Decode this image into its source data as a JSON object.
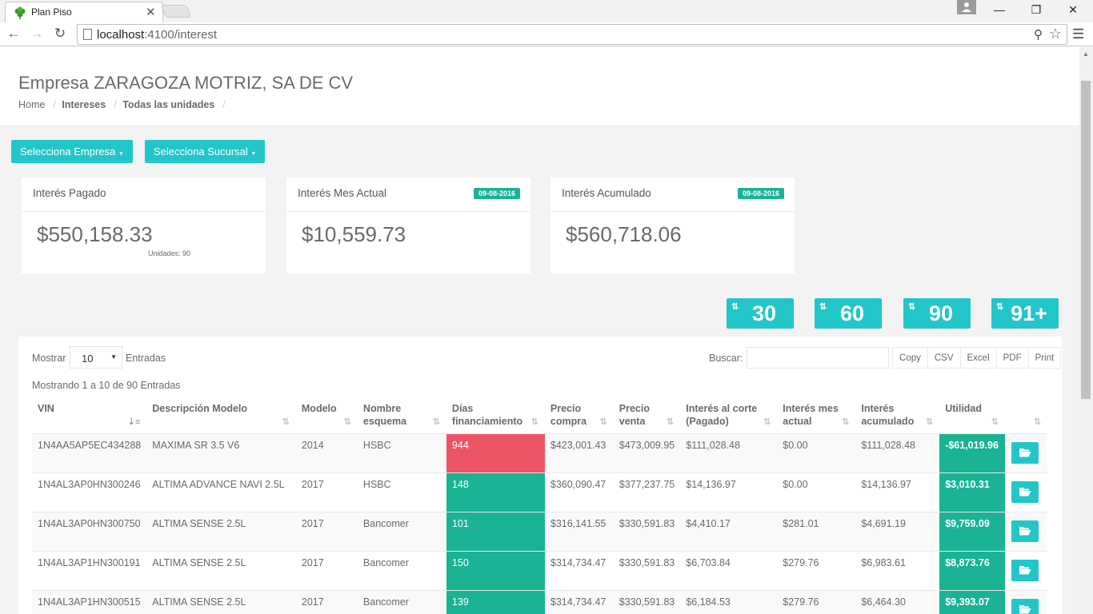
{
  "browser": {
    "tab_title": "Plan Piso",
    "url_host": "localhost",
    "url_rest": ":4100/interest"
  },
  "header": {
    "title": "Empresa ZARAGOZA MOTRIZ, SA DE CV",
    "breadcrumb": [
      "Home",
      "Intereses",
      "Todas las unidades"
    ]
  },
  "filters": {
    "empresa_label": "Selecciona Empresa",
    "sucursal_label": "Selecciona Sucursal"
  },
  "cards": [
    {
      "title": "Interés Pagado",
      "value": "$550,158.33",
      "sub": "Unidades: 90",
      "badge": ""
    },
    {
      "title": "Interés Mes Actual",
      "value": "$10,559.73",
      "sub": "",
      "badge": "09-08-2016"
    },
    {
      "title": "Interés Acumulado",
      "value": "$560,718.06",
      "sub": "",
      "badge": "09-08-2016"
    }
  ],
  "ranges": [
    "30",
    "60",
    "90",
    "91+"
  ],
  "table": {
    "show_label": "Mostrar",
    "length_value": "10",
    "entries_label": "Entradas",
    "search_label": "Buscar:",
    "exports": [
      "Copy",
      "CSV",
      "Excel",
      "PDF",
      "Print"
    ],
    "info": "Mostrando 1 a 10 de 90 Entradas",
    "columns": [
      "VIN",
      "Descripción Modelo",
      "Modelo",
      "Nombre esquema",
      "Días financiamiento",
      "Precio compra",
      "Precio venta",
      "Interés al corte (Pagado)",
      "Interés mes actual",
      "Interés acumulado",
      "Utilidad",
      ""
    ],
    "rows": [
      {
        "vin": "1N4AA5AP5EC434288",
        "desc": "MAXIMA SR 3.5 V6",
        "modelo": "2014",
        "esquema": "HSBC",
        "dias": "944",
        "dias_status": "red",
        "compra": "$423,001.43",
        "venta": "$473,009.95",
        "corte": "$111,028.48",
        "mes": "$0.00",
        "acum": "$111,028.48",
        "util": "-$61,019.96"
      },
      {
        "vin": "1N4AL3AP0HN300246",
        "desc": "ALTIMA ADVANCE NAVI 2.5L",
        "modelo": "2017",
        "esquema": "HSBC",
        "dias": "148",
        "dias_status": "green",
        "compra": "$360,090.47",
        "venta": "$377,237.75",
        "corte": "$14,136.97",
        "mes": "$0.00",
        "acum": "$14,136.97",
        "util": "$3,010.31"
      },
      {
        "vin": "1N4AL3AP0HN300750",
        "desc": "ALTIMA SENSE 2.5L",
        "modelo": "2017",
        "esquema": "Bancomer",
        "dias": "101",
        "dias_status": "green",
        "compra": "$316,141.55",
        "venta": "$330,591.83",
        "corte": "$4,410.17",
        "mes": "$281.01",
        "acum": "$4,691.19",
        "util": "$9,759.09"
      },
      {
        "vin": "1N4AL3AP1HN300191",
        "desc": "ALTIMA SENSE 2.5L",
        "modelo": "2017",
        "esquema": "Bancomer",
        "dias": "150",
        "dias_status": "green",
        "compra": "$314,734.47",
        "venta": "$330,591.83",
        "corte": "$6,703.84",
        "mes": "$279.76",
        "acum": "$6,983.61",
        "util": "$8,873.76"
      },
      {
        "vin": "1N4AL3AP1HN300515",
        "desc": "ALTIMA SENSE 2.5L",
        "modelo": "2017",
        "esquema": "Bancomer",
        "dias": "139",
        "dias_status": "green",
        "compra": "$314,734.47",
        "venta": "$330,591.83",
        "corte": "$6,184.53",
        "mes": "$279.76",
        "acum": "$6,464.30",
        "util": "$9,393.07"
      }
    ]
  },
  "colors": {
    "teal": "#23c6c8",
    "green": "#1ab394",
    "red": "#ed5565"
  }
}
